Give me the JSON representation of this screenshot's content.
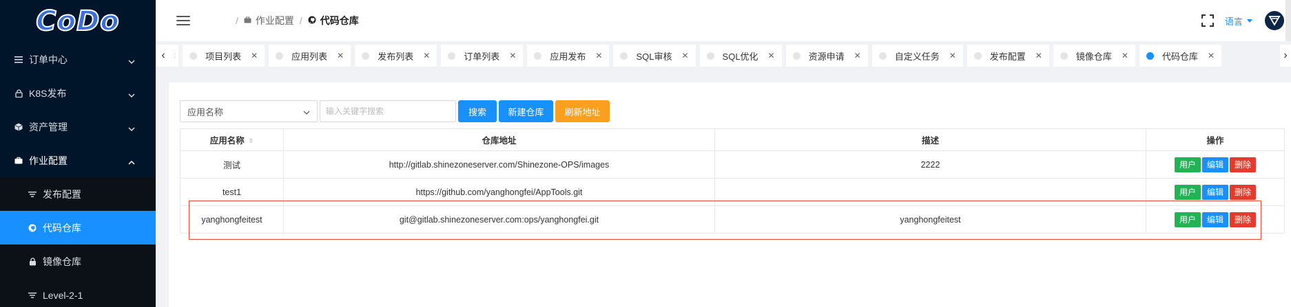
{
  "logo": {
    "text": "CoDo"
  },
  "sidebar": {
    "items": [
      {
        "label": "订单中心",
        "icon": "menu-lines-icon",
        "expanded": false
      },
      {
        "label": "K8S发布",
        "icon": "lock-icon",
        "expanded": false
      },
      {
        "label": "资产管理",
        "icon": "cube-icon",
        "expanded": false
      },
      {
        "label": "作业配置",
        "icon": "briefcase-icon",
        "expanded": true
      }
    ],
    "subitems": [
      {
        "label": "发布配置",
        "icon": "filter-icon",
        "active": false
      },
      {
        "label": "代码仓库",
        "icon": "github-icon",
        "active": true
      },
      {
        "label": "镜像仓库",
        "icon": "lock-icon",
        "active": false
      },
      {
        "label": "Level-2-1",
        "icon": "filter-icon",
        "active": false
      }
    ]
  },
  "header": {
    "breadcrumb": [
      {
        "label": "作业配置",
        "icon": "briefcase-icon"
      },
      {
        "label": "代码仓库",
        "icon": "github-icon"
      }
    ],
    "language": "语言"
  },
  "tabs": [
    {
      "label": "项目列表",
      "active": false
    },
    {
      "label": "应用列表",
      "active": false
    },
    {
      "label": "发布列表",
      "active": false
    },
    {
      "label": "订单列表",
      "active": false
    },
    {
      "label": "应用发布",
      "active": false
    },
    {
      "label": "SQL审核",
      "active": false
    },
    {
      "label": "SQL优化",
      "active": false
    },
    {
      "label": "资源申请",
      "active": false
    },
    {
      "label": "自定义任务",
      "active": false
    },
    {
      "label": "发布配置",
      "active": false
    },
    {
      "label": "镜像仓库",
      "active": false
    },
    {
      "label": "代码仓库",
      "active": true
    }
  ],
  "toolbar": {
    "select_value": "应用名称",
    "search_placeholder": "输入关键字搜索",
    "search_label": "搜索",
    "new_label": "新建仓库",
    "refresh_label": "刷新地址"
  },
  "table": {
    "columns": [
      "应用名称",
      "仓库地址",
      "描述",
      "操作"
    ],
    "rows": [
      {
        "name": "测试",
        "url": "http://gitlab.shinezoneserver.com/Shinezone-OPS/images",
        "desc": "2222"
      },
      {
        "name": "test1",
        "url": "https://github.com/yanghongfei/AppTools.git",
        "desc": ""
      },
      {
        "name": "yanghongfeitest",
        "url": "git@gitlab.shinezoneserver.com:ops/yanghongfei.git",
        "desc": "yanghongfeitest"
      }
    ],
    "actions": {
      "user": "用户",
      "edit": "编辑",
      "delete": "删除"
    }
  },
  "colors": {
    "accent": "#1890ff",
    "sidebar_bg": "#001529",
    "highlight": "#e74c3c",
    "orange": "#faa01e"
  }
}
